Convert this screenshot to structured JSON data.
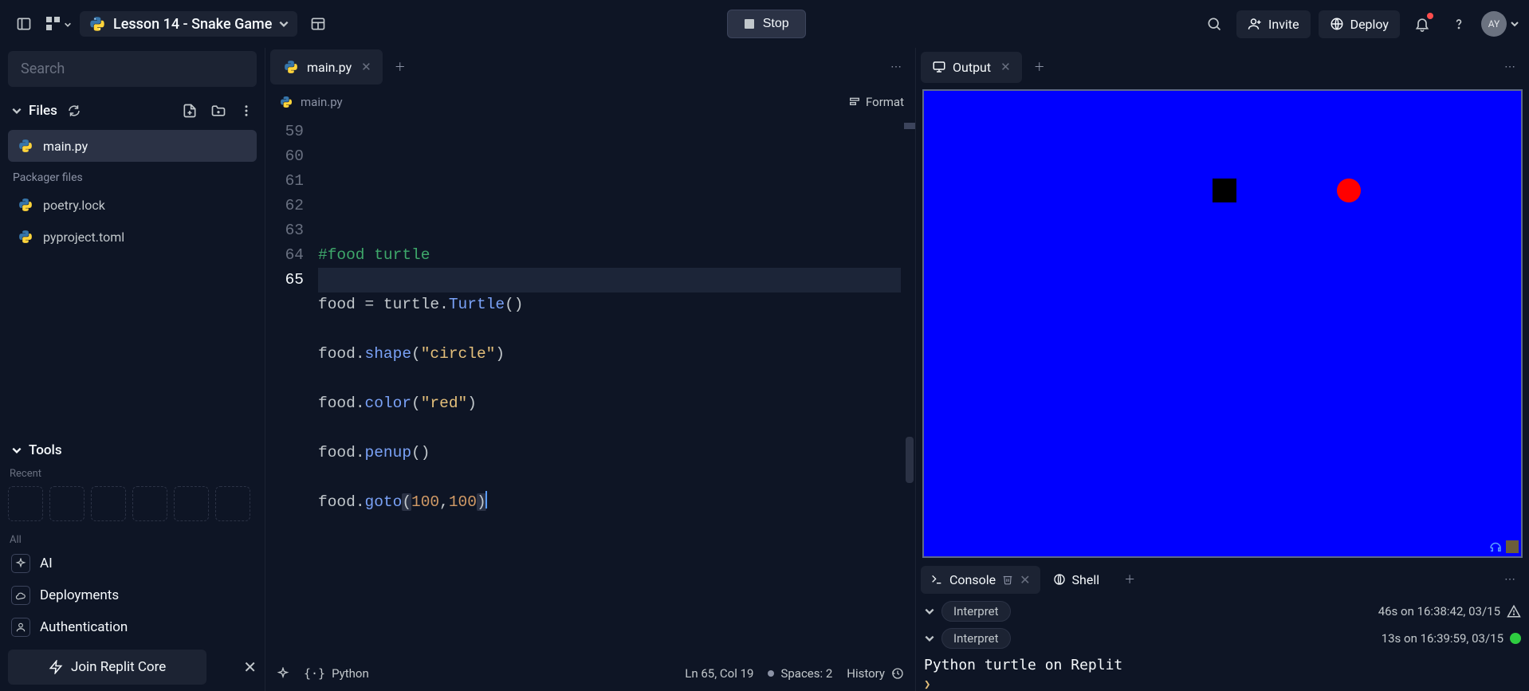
{
  "header": {
    "project_title": "Lesson 14 - Snake Game",
    "run_label": "Stop",
    "invite_label": "Invite",
    "deploy_label": "Deploy",
    "avatar_initials": "AY"
  },
  "sidebar": {
    "search_placeholder": "Search",
    "files_label": "Files",
    "files": [
      {
        "name": "main.py",
        "active": true
      }
    ],
    "packager_label": "Packager files",
    "packager_files": [
      {
        "name": "poetry.lock"
      },
      {
        "name": "pyproject.toml"
      }
    ],
    "tools_label": "Tools",
    "recent_label": "Recent",
    "all_label": "All",
    "tools": [
      {
        "name": "AI"
      },
      {
        "name": "Deployments"
      },
      {
        "name": "Authentication"
      }
    ],
    "join_core_label": "Join Replit Core"
  },
  "editor": {
    "tab_label": "main.py",
    "breadcrumb": "main.py",
    "format_label": "Format",
    "lines": {
      "59": {
        "type": "blank"
      },
      "60": {
        "type": "comment",
        "text": "#food turtle"
      },
      "61": {
        "indent": "",
        "obj": "food",
        "op": " = ",
        "mod": "turtle",
        "dot": ".",
        "call": "Turtle",
        "args_open": "(",
        "args": "",
        "args_close": ")"
      },
      "62": {
        "indent": "",
        "obj": "food",
        "dot": ".",
        "call": "shape",
        "args_open": "(",
        "str": "\"circle\"",
        "args_close": ")"
      },
      "63": {
        "indent": "",
        "obj": "food",
        "dot": ".",
        "call": "color",
        "args_open": "(",
        "str": "\"red\"",
        "args_close": ")"
      },
      "64": {
        "indent": "",
        "obj": "food",
        "dot": ".",
        "call": "penup",
        "args_open": "(",
        "args": "",
        "args_close": ")"
      },
      "65": {
        "indent": "",
        "obj": "food",
        "dot": ".",
        "call": "goto",
        "args_open": "(",
        "num1": "100",
        "comma": ",",
        "num2": "100",
        "args_close": ")"
      }
    },
    "status": {
      "language": "Python",
      "cursor": "Ln 65, Col 19",
      "spaces": "Spaces: 2",
      "history": "History"
    }
  },
  "output": {
    "tab_label": "Output"
  },
  "console": {
    "console_tab": "Console",
    "shell_tab": "Shell",
    "entries": [
      {
        "label": "Interpret",
        "meta": "46s on 16:38:42, 03/15",
        "status": "warn"
      },
      {
        "label": "Interpret",
        "meta": "13s on 16:39:59, 03/15",
        "status": "ok"
      }
    ],
    "output_line": "Python turtle on Replit",
    "prompt": ">"
  }
}
